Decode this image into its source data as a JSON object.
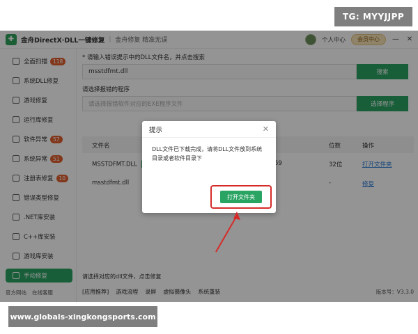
{
  "overlay": {
    "tg_badge": "TG: MYYJJPP",
    "site_banner": "www.globals-xingkongsports.com"
  },
  "titlebar": {
    "app_title": "金舟DirectX·DLL一键修复",
    "subtitle": "金舟修复 精准无误",
    "user_center": "个人中心",
    "vip": "会员中心",
    "minimize": "—",
    "close": "✕"
  },
  "sidebar": {
    "items": [
      {
        "label": "全面扫描",
        "badge": "118"
      },
      {
        "label": "系统DLL修复",
        "badge": ""
      },
      {
        "label": "游戏修复",
        "badge": ""
      },
      {
        "label": "运行库修复",
        "badge": ""
      },
      {
        "label": "软件异常",
        "badge": "57"
      },
      {
        "label": "系统异常",
        "badge": "51"
      },
      {
        "label": "注册表修复",
        "badge": "10"
      },
      {
        "label": "错误类型修复",
        "badge": ""
      },
      {
        "label": ".NET库安装",
        "badge": ""
      },
      {
        "label": "C++库安装",
        "badge": ""
      },
      {
        "label": "游戏库安装",
        "badge": ""
      },
      {
        "label": "手动修复",
        "badge": ""
      }
    ],
    "footer": [
      "官方网站",
      "在线客服"
    ]
  },
  "main": {
    "search_label": "* 请输入错误提示中的DLL文件名，并点击搜索",
    "search_value": "msstdfmt.dll",
    "search_button": "搜索",
    "program_label": "请选择报错的程序",
    "program_placeholder": "请选择报错软件对应的EXE程序文件",
    "program_button": "选择程序",
    "table": {
      "headers": [
        "文件名",
        "位数",
        "操作"
      ],
      "rows": [
        {
          "name": "MSSTDFMT.DLL",
          "mid": "59",
          "bits": "32位",
          "action": "打开文件夹"
        },
        {
          "name": "msstdfmt.dll",
          "mid": "",
          "bits": "-",
          "action": "修复"
        }
      ]
    },
    "status_text": "请选择对应的dll文件，点击修复",
    "bottom_links": [
      "[应用推荐]",
      "游戏流程",
      "录屏",
      "虚拟摄像头",
      "系统重装"
    ],
    "version": "版本号：V3.3.0"
  },
  "dialog": {
    "title": "提示",
    "close": "✕",
    "message": "DLL文件已下载完成，请将DLL文件放到系统目录或者软件目录下",
    "button": "打开文件夹"
  },
  "colors": {
    "accent": "#2aa463",
    "highlight": "#d62a2a"
  }
}
